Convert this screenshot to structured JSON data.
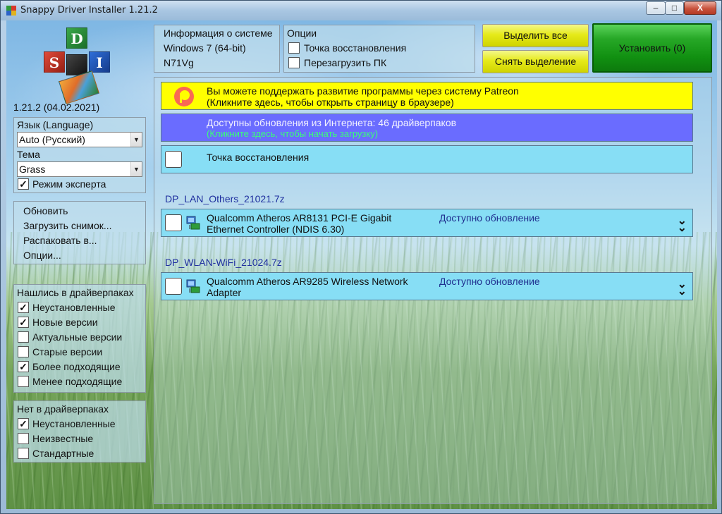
{
  "window": {
    "title": "Snappy Driver Installer 1.21.2",
    "controls": {
      "minimize": "–",
      "maximize": "□",
      "close": "X"
    }
  },
  "logo": {
    "letters": [
      "D",
      "S",
      "I",
      ""
    ]
  },
  "version": "1.21.2 (04.02.2021)",
  "language": {
    "label": "Язык (Language)",
    "value": "Auto (Русский)",
    "theme_label": "Тема",
    "theme_value": "Grass",
    "expert_mode": {
      "label": "Режим эксперта",
      "checked": true
    }
  },
  "actions": [
    "Обновить",
    "Загрузить снимок...",
    "Распаковать в...",
    "Опции..."
  ],
  "found_filter": {
    "title": "Нашлись в драйверпаках",
    "items": [
      {
        "label": "Неустановленные",
        "checked": true
      },
      {
        "label": "Новые версии",
        "checked": true
      },
      {
        "label": "Актуальные версии",
        "checked": false
      },
      {
        "label": "Старые версии",
        "checked": false
      },
      {
        "label": "Более подходящие",
        "checked": true
      },
      {
        "label": "Менее подходящие",
        "checked": false
      }
    ]
  },
  "notfound_filter": {
    "title": "Нет в драйверпаках",
    "items": [
      {
        "label": "Неустановленные",
        "checked": true
      },
      {
        "label": "Неизвестные",
        "checked": false
      },
      {
        "label": "Стандартные",
        "checked": false
      }
    ]
  },
  "sysinfo": {
    "title": "Информация о системе",
    "os": "Windows 7 (64-bit)",
    "machine": "N71Vg"
  },
  "options": {
    "title": "Опции",
    "restore_point": {
      "label": "Точка восстановления",
      "checked": false
    },
    "reboot": {
      "label": "Перезагрузить ПК",
      "checked": false
    }
  },
  "buttons": {
    "select_all": "Выделить все",
    "deselect": "Снять выделение",
    "install": "Установить (0)"
  },
  "banners": {
    "patreon_line1": "Вы можете поддержать развитие программы через систему Patreon",
    "patreon_line2": "(Кликните здесь, чтобы открыть страницу в браузере)",
    "updates_line1": "Доступны обновления из Интернета: 46 драйверпаков",
    "updates_line2": "(Кликните здесь, чтобы начать загрузку)",
    "restore_point": "Точка восстановления"
  },
  "driverpacks": [
    {
      "name": "DP_LAN_Others_21021.7z",
      "device_line1": "Qualcomm Atheros AR8131 PCI-E Gigabit",
      "device_line2": "Ethernet Controller (NDIS 6.30)",
      "status": "Доступно обновление"
    },
    {
      "name": "DP_WLAN-WiFi_21024.7z",
      "device_line1": "Qualcomm Atheros AR9285 Wireless Network",
      "device_line2": "Adapter",
      "status": "Доступно обновление"
    }
  ],
  "colors": {
    "patreon_banner": "#ffff00",
    "updates_banner": "#6a6cff",
    "row_bg": "#87def5",
    "install_green": "#119011",
    "yellow_button": "#e6ea1a",
    "link_green": "#39ff7a",
    "pack_title_blue": "#1f2f9f"
  },
  "icons": {
    "app": "sdi-app-icon",
    "patreon": "patreon-icon",
    "network_device": "network-device-icon",
    "expand": "chevron-double-down-icon"
  }
}
